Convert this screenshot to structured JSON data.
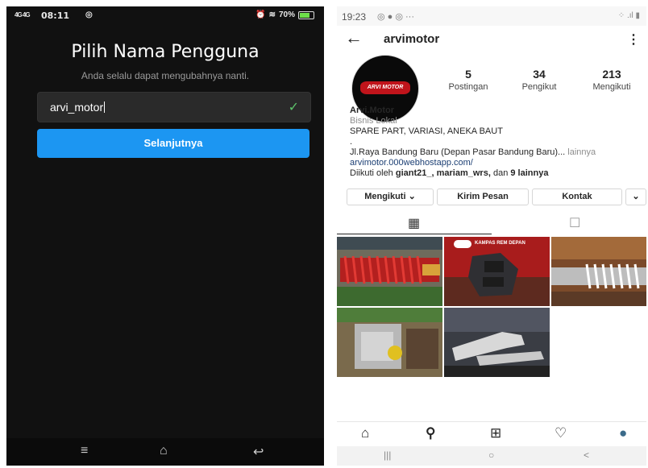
{
  "left": {
    "status": {
      "signal": "4G 4G",
      "time": "08:11",
      "right_icon": "◎",
      "battery": "70%"
    },
    "title": "Pilih Nama Pengguna",
    "subtitle": "Anda selalu dapat mengubahnya nanti.",
    "input": {
      "value": "arvi_motor"
    },
    "button_label": "Selanjutnya",
    "nav": {
      "menu": "≡",
      "home": "⌂",
      "back": "↩"
    }
  },
  "right": {
    "status": {
      "time": "19:23",
      "icons": "◎ ● ◎ ···",
      "right": "⁘ .ıl ▮"
    },
    "header": {
      "back": "←",
      "username": "arvimotor",
      "more": "⋮"
    },
    "avatar_text": "ARVI MOTOR",
    "stats": [
      {
        "value": "5",
        "label": "Postingan"
      },
      {
        "value": "34",
        "label": "Pengikut"
      },
      {
        "value": "213",
        "label": "Mengikuti"
      }
    ],
    "bio": {
      "name": "Arvi.Motor",
      "category": "Bisnis Lokal",
      "line1": "SPARE PART, VARIASI, ANEKA BAUT",
      "dot": ".",
      "address": "Jl.Raya Bandung Baru (Depan Pasar Bandung Baru)...",
      "more": "lainnya",
      "link": "arvimotor.000webhostapp.com/",
      "followed_prefix": "Diikuti oleh",
      "followed_names": "giant21_, mariam_wrs,",
      "followed_and": "dan",
      "followed_count": "9 lainnya"
    },
    "buttons": {
      "following": "Mengikuti ⌄",
      "message": "Kirim Pesan",
      "contact": "Kontak",
      "dropdown": "⌄"
    },
    "posts": [
      {
        "caption": ""
      },
      {
        "caption": "KAMPAS REM DEPAN"
      },
      {
        "caption": ""
      },
      {
        "caption": ""
      },
      {
        "caption": ""
      }
    ],
    "tabbar": {
      "home": "⌂",
      "search": "⚲",
      "add": "⊞",
      "heart": "♡",
      "profile": "●"
    },
    "nav": {
      "recent": "|||",
      "home": "○",
      "back": "<"
    }
  }
}
